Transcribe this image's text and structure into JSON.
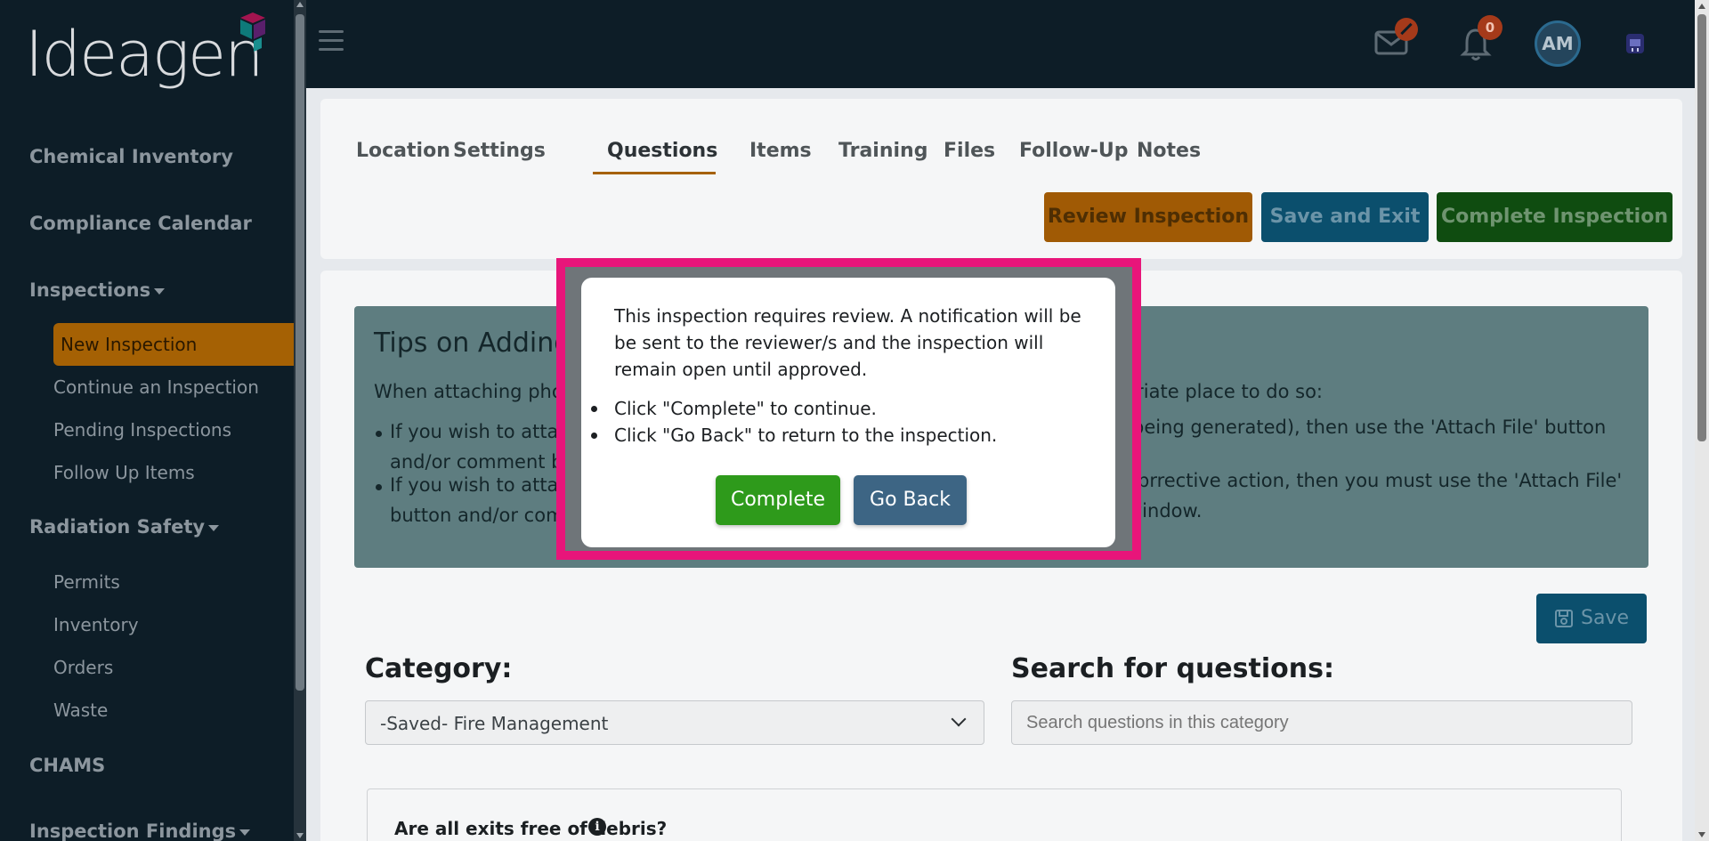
{
  "brand": {
    "logo_text": "Ideagen"
  },
  "sidebar": {
    "items": [
      {
        "label": "Chemical Inventory"
      },
      {
        "label": "Compliance Calendar"
      },
      {
        "label": "Inspections"
      },
      {
        "label": "New Inspection"
      },
      {
        "label": "Continue an Inspection"
      },
      {
        "label": "Pending Inspections"
      },
      {
        "label": "Follow Up Items"
      },
      {
        "label": "Radiation Safety"
      },
      {
        "label": "Permits"
      },
      {
        "label": "Inventory"
      },
      {
        "label": "Orders"
      },
      {
        "label": "Waste"
      },
      {
        "label": "CHAMS"
      },
      {
        "label": "Inspection Findings"
      }
    ]
  },
  "header": {
    "notification_count": "0",
    "avatar_initials": "AM"
  },
  "tabs": [
    {
      "label": "Location"
    },
    {
      "label": "Settings"
    },
    {
      "label": "Questions"
    },
    {
      "label": "Items"
    },
    {
      "label": "Training"
    },
    {
      "label": "Files"
    },
    {
      "label": "Follow-Up"
    },
    {
      "label": "Notes"
    }
  ],
  "actions": {
    "review": "Review Inspection",
    "save_exit": "Save and Exit",
    "complete": "Complete Inspection"
  },
  "tips": {
    "title": "Tips on Adding Pl",
    "line1_left": "When attaching pho",
    "line1_right": "opriate place to do so:",
    "b1_l1": "If you wish to atta",
    "b1_l2": "and/or comment b",
    "b1_right": "peing generated), then use the 'Attach File' button",
    "b2_l1": "If you wish to atta",
    "b2_l2": "button and/or com",
    "b2_right": "prrective action, then you must use the 'Attach File'",
    "b2_right2": "window."
  },
  "save_label": "Save",
  "category": {
    "label": "Category:",
    "selected": "-Saved- Fire Management"
  },
  "search": {
    "label": "Search for questions:",
    "placeholder": "Search questions in this category"
  },
  "question": {
    "text": "Are all exits free of debris?"
  },
  "modal": {
    "message": "This inspection requires review. A notification will be be sent to the reviewer/s and the inspection will remain open until approved.",
    "bullet1": "Click \"Complete\" to continue.",
    "bullet2": "Click \"Go Back\" to return to the inspection.",
    "complete_label": "Complete",
    "goback_label": "Go Back"
  },
  "colors": {
    "highlight": "#e8157a",
    "complete_button": "#2e9a1b",
    "goback_button": "#3d6584",
    "active_nav": "#a56104"
  }
}
